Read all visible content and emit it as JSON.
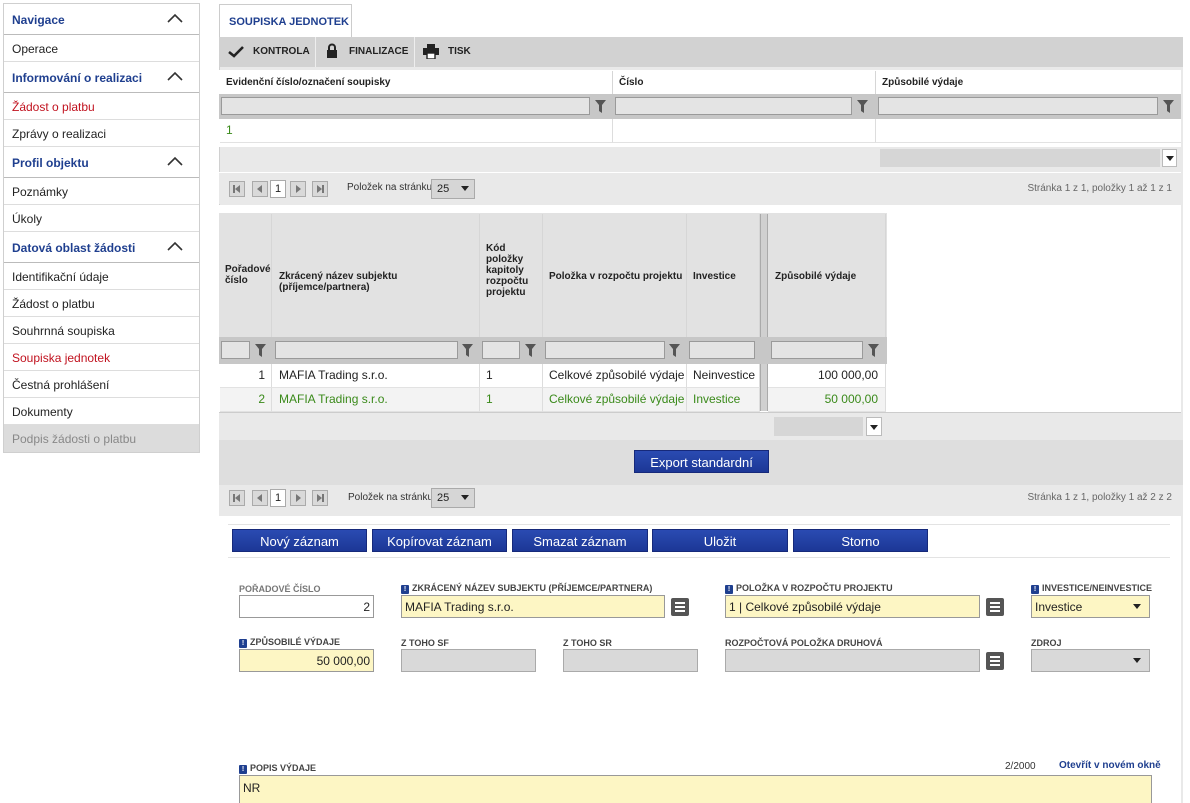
{
  "sidebar": {
    "sections": [
      {
        "title": "Navigace",
        "items": [
          {
            "label": "Operace"
          }
        ]
      },
      {
        "title": "Informování o realizaci",
        "items": [
          {
            "label": "Žádost o platbu"
          },
          {
            "label": "Zprávy o realizaci"
          }
        ]
      },
      {
        "title": "Profil objektu",
        "items": [
          {
            "label": "Poznámky"
          },
          {
            "label": "Úkoly"
          }
        ]
      },
      {
        "title": "Datová oblast žádosti",
        "items": [
          {
            "label": "Identifikační údaje"
          },
          {
            "label": "Žádost o platbu"
          },
          {
            "label": "Souhrnná soupiska"
          },
          {
            "label": "Soupiska jednotek"
          },
          {
            "label": "Čestná prohlášení"
          },
          {
            "label": "Dokumenty"
          },
          {
            "label": "Podpis žádosti o platbu"
          }
        ]
      }
    ]
  },
  "tab": {
    "label": "SOUPISKA JEDNOTEK"
  },
  "toolbar": {
    "kontrola": "KONTROLA",
    "finalizace": "FINALIZACE",
    "tisk": "TISK"
  },
  "grid1": {
    "headers": [
      "Evidenční číslo/označení soupisky",
      "Číslo",
      "Způsobilé výdaje"
    ],
    "rows": [
      [
        "1",
        "",
        ""
      ]
    ]
  },
  "pager1": {
    "page": "1",
    "per_page_label": "Položek na stránku",
    "per_page": "25",
    "info": "Stránka 1 z 1, položky 1 až 1 z 1"
  },
  "grid2": {
    "headers": [
      "Pořadové číslo",
      "Zkrácený název subjektu (příjemce/partnera)",
      "Kód položky kapitoly rozpočtu projektu",
      "Položka v rozpočtu projektu",
      "Investice",
      "Způsobilé výdaje"
    ],
    "rows": [
      [
        "1",
        "MAFIA Trading s.r.o.",
        "1",
        "Celkové způsobilé výdaje",
        "Neinvestice",
        "100 000,00"
      ],
      [
        "2",
        "MAFIA Trading s.r.o.",
        "1",
        "Celkové způsobilé výdaje",
        "Investice",
        "50 000,00"
      ]
    ]
  },
  "export_button": "Export standardní",
  "pager2": {
    "page": "1",
    "per_page_label": "Položek na stránku",
    "per_page": "25",
    "info": "Stránka 1 z 1, položky 1 až 2 z 2"
  },
  "actions": {
    "new": "Nový záznam",
    "copy": "Kopírovat záznam",
    "delete": "Smazat záznam",
    "save": "Uložit",
    "cancel": "Storno"
  },
  "form": {
    "poradove_label": "POŘADOVÉ ČÍSLO",
    "poradove_value": "2",
    "subjekt_label": "ZKRÁCENÝ NÁZEV SUBJEKTU (PŘÍJEMCE/PARTNERA)",
    "subjekt_value": "MAFIA Trading s.r.o.",
    "polozka_label": "POLOŽKA V ROZPOČTU PROJEKTU",
    "polozka_value": "1 | Celkové způsobilé výdaje",
    "investice_label": "INVESTICE/NEINVESTICE",
    "investice_value": "Investice",
    "vydaje_label": "ZPŮSOBILÉ VÝDAJE",
    "vydaje_value": "50 000,00",
    "sf_label": "Z TOHO SF",
    "sr_label": "Z TOHO SR",
    "druhova_label": "ROZPOČTOVÁ POLOŽKA DRUHOVÁ",
    "zdroj_label": "ZDROJ",
    "popis_label": "POPIS VÝDAJE",
    "popis_counter": "2/2000",
    "popis_open": "Otevřít v novém okně",
    "popis_value": "NR"
  },
  "colors": {
    "accent": "#1f3f8f",
    "active_red": "#c1121f",
    "green_row": "#3a8a1a",
    "required_bg": "#fdf6c4"
  }
}
